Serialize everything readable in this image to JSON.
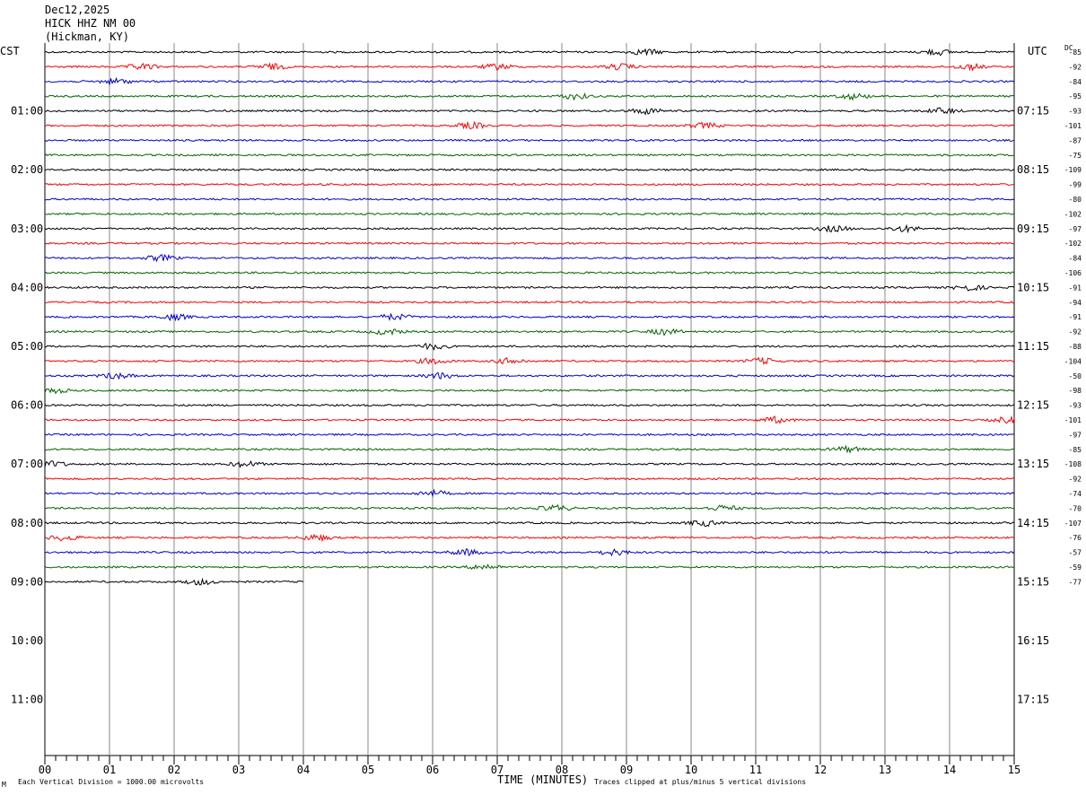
{
  "header": {
    "date": "Dec12,2025",
    "station": "HICK HHZ NM 00",
    "location": "(Hickman, KY)"
  },
  "left_axis_label": "CST",
  "right_axis_label": "UTC",
  "dc_label": "DC",
  "footer": {
    "scale_note": "Each Vertical Division = 1000.00 microvolts",
    "xlabel": "TIME (MINUTES)",
    "clip_note": "Traces clipped at plus/minus 5 vertical divisions",
    "corner_mark": "M"
  },
  "chart_data": {
    "type": "line",
    "title": "HICK HHZ NM 00",
    "xlabel": "TIME (MINUTES)",
    "xlim": [
      0,
      15
    ],
    "x_ticks": [
      "00",
      "01",
      "02",
      "03",
      "04",
      "05",
      "06",
      "07",
      "08",
      "09",
      "10",
      "11",
      "12",
      "13",
      "14",
      "15"
    ],
    "grid": true,
    "trace_colors": [
      "#000000",
      "#ff0000",
      "#0000cc",
      "#006400"
    ],
    "hour_labels": [
      {
        "cst": "01:00",
        "utc": "07:15",
        "row": 4
      },
      {
        "cst": "02:00",
        "utc": "08:15",
        "row": 8
      },
      {
        "cst": "03:00",
        "utc": "09:15",
        "row": 12
      },
      {
        "cst": "04:00",
        "utc": "10:15",
        "row": 16
      },
      {
        "cst": "05:00",
        "utc": "11:15",
        "row": 20
      },
      {
        "cst": "06:00",
        "utc": "12:15",
        "row": 24
      },
      {
        "cst": "07:00",
        "utc": "13:15",
        "row": 28
      },
      {
        "cst": "08:00",
        "utc": "14:15",
        "row": 32
      },
      {
        "cst": "09:00",
        "utc": "15:15",
        "row": 36
      },
      {
        "cst": "10:00",
        "utc": "16:15",
        "row": 40
      },
      {
        "cst": "11:00",
        "utc": "17:15",
        "row": 44
      }
    ],
    "dc_offsets": [
      "-85",
      "-92",
      "-84",
      "-95",
      "-93",
      "-101",
      "-87",
      "-75",
      "-109",
      "-99",
      "-80",
      "-102",
      "-97",
      "-102",
      "-84",
      "-106",
      "-91",
      "-94",
      "-91",
      "-92",
      "-88",
      "-104",
      "-50",
      "-98",
      "-93",
      "-101",
      "-97",
      "-85",
      "-108",
      "-92",
      "-74",
      "-70",
      "-107",
      "-76",
      "-57",
      "-59",
      "-77"
    ],
    "traces_total": 37,
    "last_trace_minutes": 4,
    "bursts": [
      {
        "row": 0,
        "x": [
          9.3,
          13.8
        ]
      },
      {
        "row": 1,
        "x": [
          1.5,
          3.5,
          7.0,
          8.9,
          14.3
        ]
      },
      {
        "row": 2,
        "x": [
          1.1
        ]
      },
      {
        "row": 3,
        "x": [
          8.2,
          12.5
        ]
      },
      {
        "row": 4,
        "x": [
          9.3,
          13.9
        ]
      },
      {
        "row": 5,
        "x": [
          6.6,
          10.2
        ]
      },
      {
        "row": 12,
        "x": [
          12.2,
          13.3
        ]
      },
      {
        "row": 14,
        "x": [
          1.8
        ]
      },
      {
        "row": 16,
        "x": [
          14.3
        ]
      },
      {
        "row": 18,
        "x": [
          2.0,
          5.4
        ]
      },
      {
        "row": 19,
        "x": [
          5.3,
          9.6
        ]
      },
      {
        "row": 20,
        "x": [
          6.0
        ]
      },
      {
        "row": 21,
        "x": [
          6.0,
          7.2,
          11.1
        ]
      },
      {
        "row": 22,
        "x": [
          1.1,
          6.1
        ]
      },
      {
        "row": 23,
        "x": [
          0.1
        ]
      },
      {
        "row": 25,
        "x": [
          11.3,
          14.9
        ]
      },
      {
        "row": 27,
        "x": [
          12.4
        ]
      },
      {
        "row": 28,
        "x": [
          0.1,
          3.1
        ]
      },
      {
        "row": 30,
        "x": [
          6.0
        ]
      },
      {
        "row": 31,
        "x": [
          7.9,
          10.5
        ]
      },
      {
        "row": 32,
        "x": [
          10.2
        ]
      },
      {
        "row": 33,
        "x": [
          0.3,
          4.2
        ]
      },
      {
        "row": 34,
        "x": [
          6.5,
          8.8
        ]
      },
      {
        "row": 35,
        "x": [
          6.8
        ]
      },
      {
        "row": 36,
        "x": [
          2.4
        ]
      }
    ]
  }
}
